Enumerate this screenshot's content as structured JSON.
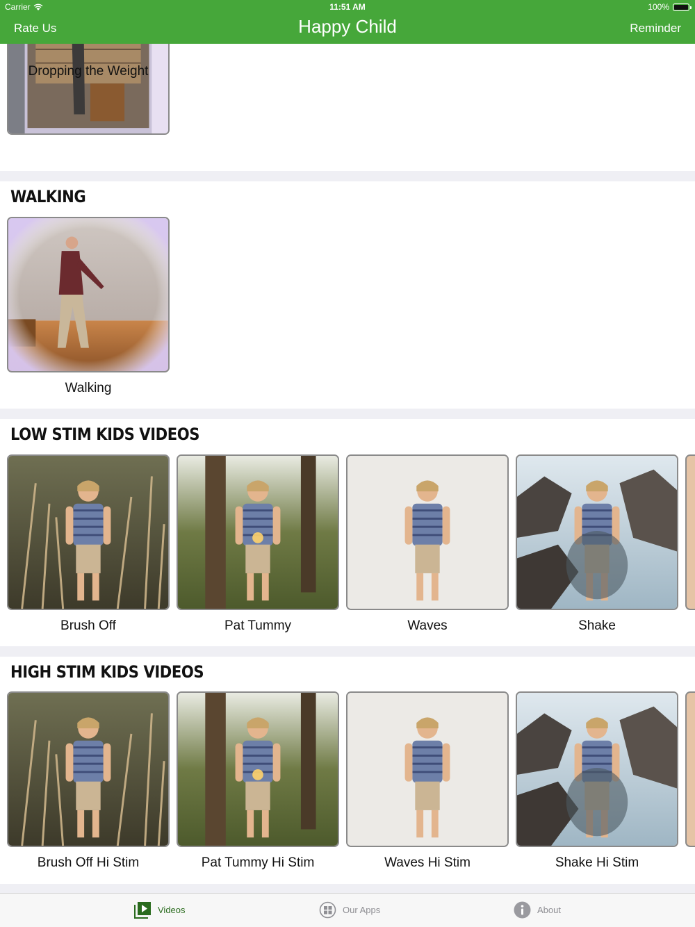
{
  "status_bar": {
    "carrier": "Carrier",
    "time": "11:51 AM",
    "battery": "100%"
  },
  "nav": {
    "left_label": "Rate Us",
    "title": "Happy Child",
    "right_label": "Reminder"
  },
  "sections": [
    {
      "id": "partial",
      "title": "",
      "items": [
        {
          "label": "Dropping the Weight",
          "thumb": "elder-doorway"
        }
      ]
    },
    {
      "id": "walking",
      "title": "WALKING",
      "items": [
        {
          "label": "Walking",
          "thumb": "elder-stage"
        }
      ]
    },
    {
      "id": "low",
      "title": "LOW STIM KIDS VIDEOS",
      "items": [
        {
          "label": "Brush Off",
          "thumb": "kid-grass"
        },
        {
          "label": "Pat Tummy",
          "thumb": "kid-forest"
        },
        {
          "label": "Waves",
          "thumb": "kid-plain"
        },
        {
          "label": "Shake",
          "thumb": "kid-rocks"
        }
      ]
    },
    {
      "id": "high",
      "title": "HIGH STIM KIDS VIDEOS",
      "items": [
        {
          "label": "Brush Off Hi Stim",
          "thumb": "kid-grass"
        },
        {
          "label": "Pat Tummy Hi Stim",
          "thumb": "kid-forest"
        },
        {
          "label": "Waves Hi Stim",
          "thumb": "kid-plain"
        },
        {
          "label": "Shake Hi Stim",
          "thumb": "kid-rocks"
        }
      ]
    }
  ],
  "tabs": [
    {
      "label": "Videos",
      "icon": "play-video-icon",
      "active": true
    },
    {
      "label": "Our Apps",
      "icon": "apps-grid-icon",
      "active": false
    },
    {
      "label": "About",
      "icon": "info-icon",
      "active": false
    }
  ],
  "colors": {
    "nav_bar": "#46a73a",
    "tab_active": "#2a6b1e",
    "tab_inactive": "#8e8e93",
    "separator": "#efeff4"
  }
}
